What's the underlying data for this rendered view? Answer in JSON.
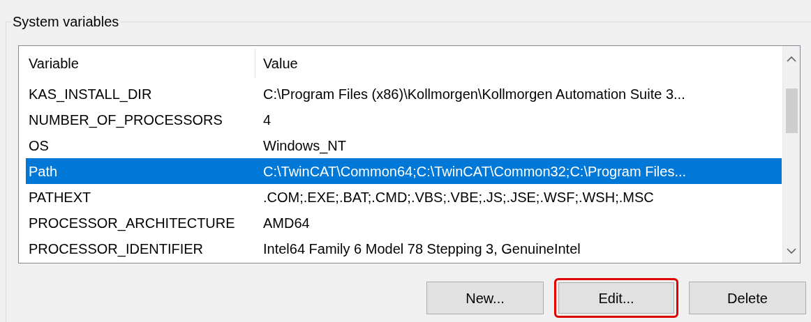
{
  "group": {
    "title": "System variables"
  },
  "table": {
    "columns": [
      "Variable",
      "Value"
    ],
    "rows": [
      {
        "variable": "KAS_INSTALL_DIR",
        "value": "C:\\Program Files (x86)\\Kollmorgen\\Kollmorgen Automation Suite 3...",
        "selected": false
      },
      {
        "variable": "NUMBER_OF_PROCESSORS",
        "value": "4",
        "selected": false
      },
      {
        "variable": "OS",
        "value": "Windows_NT",
        "selected": false
      },
      {
        "variable": "Path",
        "value": "C:\\TwinCAT\\Common64;C:\\TwinCAT\\Common32;C:\\Program Files...",
        "selected": true
      },
      {
        "variable": "PATHEXT",
        "value": ".COM;.EXE;.BAT;.CMD;.VBS;.VBE;.JS;.JSE;.WSF;.WSH;.MSC",
        "selected": false
      },
      {
        "variable": "PROCESSOR_ARCHITECTURE",
        "value": "AMD64",
        "selected": false
      },
      {
        "variable": "PROCESSOR_IDENTIFIER",
        "value": "Intel64 Family 6 Model 78 Stepping 3, GenuineIntel",
        "selected": false
      }
    ]
  },
  "buttons": [
    {
      "label": "New...",
      "highlighted": false
    },
    {
      "label": "Edit...",
      "highlighted": true
    },
    {
      "label": "Delete",
      "highlighted": false
    }
  ]
}
